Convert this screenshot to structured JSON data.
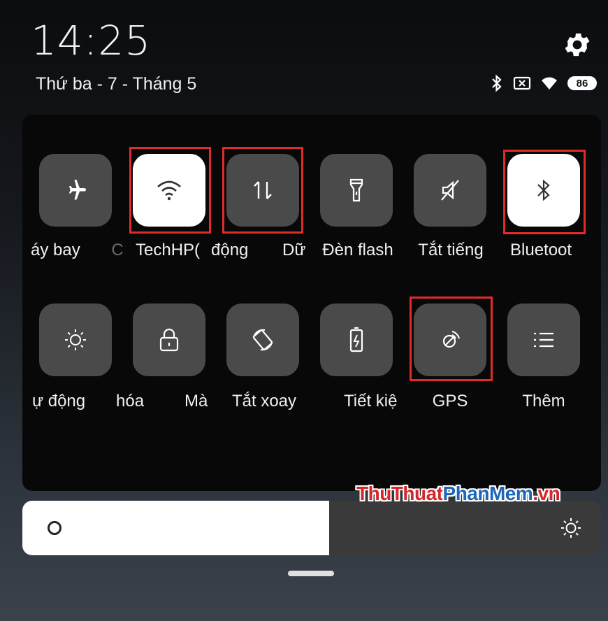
{
  "header": {
    "time": "14:25",
    "date": "Thứ ba - 7 - Tháng 5",
    "battery": "86"
  },
  "tiles_row1": [
    {
      "label": "áy bay",
      "icon": "airplane-icon",
      "active": false
    },
    {
      "label": "TechHP(",
      "icon": "wifi-icon",
      "active": true
    },
    {
      "label": "Dữ",
      "icon": "mobile-data-icon",
      "active": false
    },
    {
      "label": "Đèn flash",
      "icon": "flashlight-icon",
      "active": false
    },
    {
      "label": "Tắt tiếng",
      "icon": "mute-icon",
      "active": false
    },
    {
      "label": "Bluetoot",
      "icon": "bluetooth-icon",
      "active": true
    }
  ],
  "row1_fragments": {
    "c": "C",
    "dong": "động"
  },
  "tiles_row2": [
    {
      "label": "ự động",
      "icon": "auto-brightness-icon",
      "active": false
    },
    {
      "label": "hóa",
      "icon": "lock-icon",
      "active": false
    },
    {
      "label": "Tắt xoay",
      "icon": "rotate-icon",
      "active": false
    },
    {
      "label": "Tiết kiệ",
      "icon": "battery-saver-icon",
      "active": false
    },
    {
      "label": "GPS",
      "icon": "gps-icon",
      "active": false
    },
    {
      "label": "Thêm",
      "icon": "menu-list-icon",
      "active": false
    }
  ],
  "row2_fragments": {
    "man": "Mà"
  },
  "brightness": {
    "level": 0.53
  },
  "watermark": {
    "part1": "ThuThuat",
    "part2": "PhanMem",
    "part3": ".vn"
  },
  "colors": {
    "highlight": "#e12b2b",
    "tile_off": "#4a4a4a",
    "tile_on": "#ffffff",
    "panel": "#080808"
  }
}
